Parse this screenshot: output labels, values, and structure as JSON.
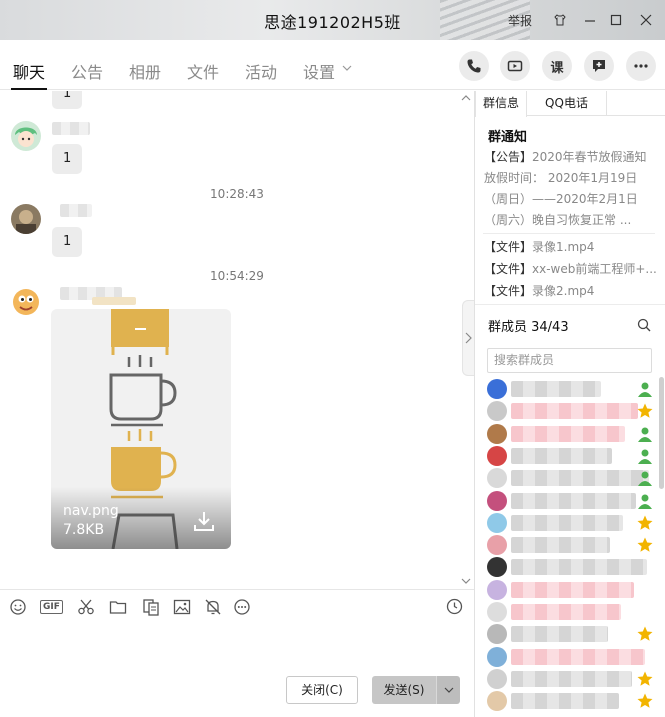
{
  "window": {
    "title": "思途191202H5班",
    "report_label": "举报"
  },
  "tabs": [
    {
      "label": "聊天",
      "active": true
    },
    {
      "label": "公告"
    },
    {
      "label": "相册"
    },
    {
      "label": "文件"
    },
    {
      "label": "活动"
    },
    {
      "label": "设置"
    }
  ],
  "header_actions": {
    "course_label": "课"
  },
  "chat": {
    "messages": [
      {
        "text": "1"
      },
      {
        "text": "1"
      },
      {
        "timestamp": "10:28:43"
      },
      {
        "text": "1"
      },
      {
        "timestamp": "10:54:29"
      },
      {
        "file": {
          "name": "nav.png",
          "size": "7.8KB"
        }
      }
    ]
  },
  "composer": {
    "gif_label": "GIF",
    "close_label": "关闭(C)",
    "send_label": "发送(S)"
  },
  "sidebar": {
    "tabs": [
      {
        "label": "群信息",
        "active": true
      },
      {
        "label": "QQ电话"
      }
    ],
    "notice_title": "群通知",
    "notice": {
      "tag": "【公告】",
      "text": "2020年春节放假通知 放假时间： 2020年1月19日（周日）——2020年2月1日（周六）晚自习恢复正常 ..."
    },
    "files": [
      {
        "tag": "【文件】",
        "name": "录像1.mp4"
      },
      {
        "tag": "【文件】",
        "name": "xx-web前端工程师+..."
      },
      {
        "tag": "【文件】",
        "name": "录像2.mp4"
      }
    ],
    "members_title": "群成员 34/43",
    "member_search_placeholder": "搜索群成员",
    "member_count_visible": 15
  },
  "colors": {
    "badge_green": "#4caf50",
    "badge_gold": "#f2b400",
    "redacted_pink": "#f7c6cc",
    "redacted_gray": "#d5d5d5",
    "cup_gold": "#e0b24f"
  }
}
